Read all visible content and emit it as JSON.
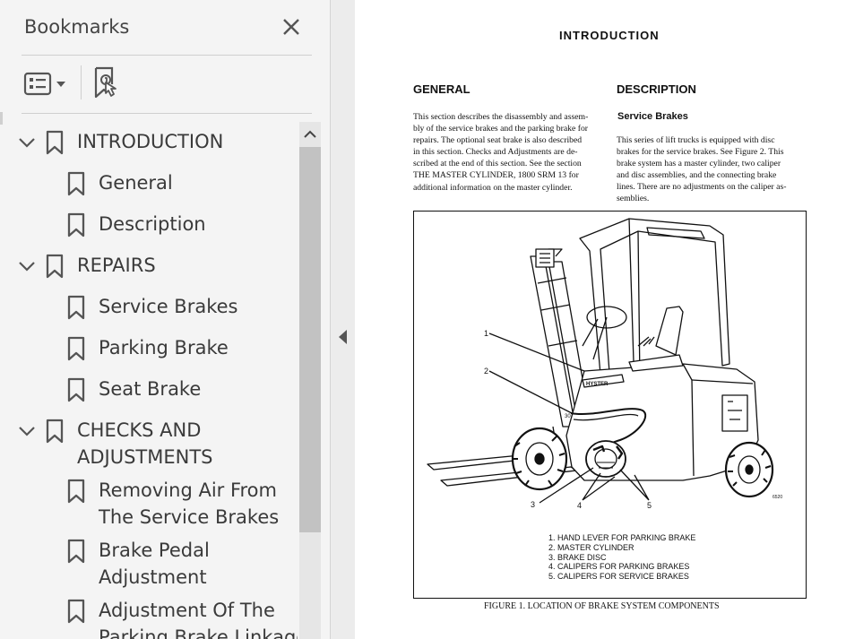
{
  "panel": {
    "title": "Bookmarks",
    "close_icon": "close-icon",
    "options_icon": "bookmark-options-icon",
    "new_bookmark_icon": "new-bookmark-icon"
  },
  "bookmarks": [
    {
      "label": "INTRODUCTION",
      "level": 0,
      "expanded": true
    },
    {
      "label": "General",
      "level": 1
    },
    {
      "label": "Description",
      "level": 1
    },
    {
      "label": "REPAIRS",
      "level": 0,
      "expanded": true
    },
    {
      "label": "Service Brakes",
      "level": 1
    },
    {
      "label": "Parking Brake",
      "level": 1
    },
    {
      "label": "Seat Brake",
      "level": 1
    },
    {
      "label": "CHECKS AND\nADJUSTMENTS",
      "level": 0,
      "expanded": true
    },
    {
      "label": "Removing Air From\nThe Service Brakes",
      "level": 1
    },
    {
      "label": "Brake Pedal\nAdjustment",
      "level": 1
    },
    {
      "label": "Adjustment Of The\nParking Brake Linkage",
      "level": 1
    }
  ],
  "document": {
    "title": "INTRODUCTION",
    "general_heading": "GENERAL",
    "general_text": [
      "This section describes the disassembly and assem-",
      "bly of the service brakes and the parking brake for",
      "repairs. The optional seat brake is also described",
      "in this section. Checks and Adjustments are de-",
      "scribed at the end of this section. See the section",
      "THE MASTER CYLINDER, 1800 SRM 13 for",
      "additional information on the master cylinder."
    ],
    "description_heading": "DESCRIPTION",
    "service_heading": "Service Brakes",
    "service_text": [
      "This series of lift trucks is equipped with disc",
      "brakes for the service brakes. See Figure 2. This",
      "brake system has a master cylinder, two caliper",
      "and disc assemblies, and the connecting brake",
      "lines. There are no adjustments on the caliper as-",
      "semblies."
    ],
    "figure": {
      "callouts": [
        "1",
        "2",
        "3",
        "4",
        "5"
      ],
      "mast_label": "HYSTER",
      "capacity_label": "30",
      "image_code": "6520",
      "legend": [
        "1. HAND LEVER FOR PARKING BRAKE",
        "2. MASTER CYLINDER",
        "3. BRAKE DISC",
        "4. CALIPERS FOR PARKING BRAKES",
        "5. CALIPERS FOR SERVICE BRAKES"
      ],
      "caption": "FIGURE 1. LOCATION OF BRAKE SYSTEM COMPONENTS"
    }
  }
}
